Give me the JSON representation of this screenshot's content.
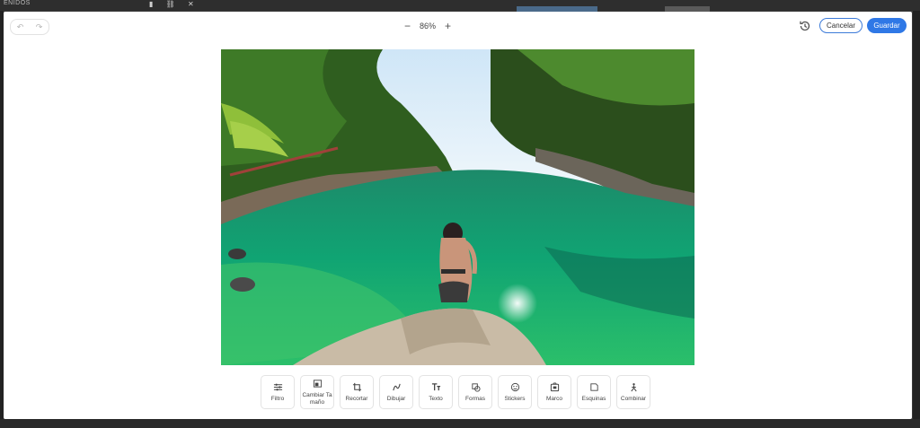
{
  "backdrop": {
    "label": "ENIDOS"
  },
  "toolbar_top": {
    "undo_icon": "undo-icon",
    "redo_icon": "redo-icon",
    "zoom_out": "−",
    "zoom_level": "86%",
    "zoom_in": "+",
    "history_icon": "history-icon",
    "cancel_label": "Cancelar",
    "save_label": "Guardar"
  },
  "photo": {
    "icon": "beach-photo"
  },
  "tools": [
    {
      "label": "Filtro",
      "icon": "sliders-icon"
    },
    {
      "label": "Cambiar Ta maño",
      "icon": "resize-icon"
    },
    {
      "label": "Recortar",
      "icon": "crop-icon"
    },
    {
      "label": "Dibujar",
      "icon": "draw-icon"
    },
    {
      "label": "Texto",
      "icon": "text-icon"
    },
    {
      "label": "Formas",
      "icon": "shapes-icon"
    },
    {
      "label": "Stickers",
      "icon": "sticker-icon"
    },
    {
      "label": "Marco",
      "icon": "frame-icon"
    },
    {
      "label": "Esquinas",
      "icon": "corners-icon"
    },
    {
      "label": "Combinar",
      "icon": "merge-icon"
    }
  ],
  "colors": {
    "accent": "#2f78e6",
    "backdrop": "#3a3a3a"
  }
}
